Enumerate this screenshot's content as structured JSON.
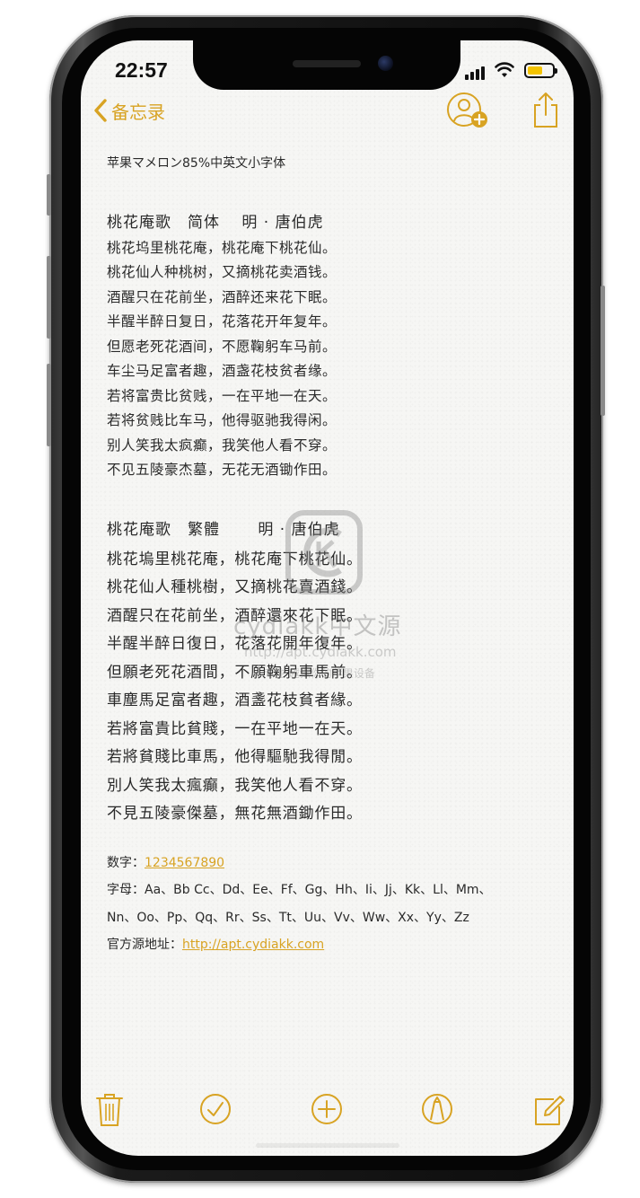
{
  "status_bar": {
    "time": "22:57"
  },
  "nav": {
    "back_label": "备忘录"
  },
  "note": {
    "title": "苹果マメロン85%中英文小字体",
    "poem_simplified": {
      "heading": "桃花庵歌　简体　 明 · 唐伯虎",
      "lines": [
        "桃花坞里桃花庵，桃花庵下桃花仙。",
        "桃花仙人种桃树，又摘桃花卖酒钱。",
        "酒醒只在花前坐，酒醉还来花下眠。",
        "半醒半醉日复日，花落花开年复年。",
        "但愿老死花酒间，不愿鞠躬车马前。",
        "车尘马足富者趣，酒盏花枝贫者缘。",
        "若将富贵比贫贱，一在平地一在天。",
        "若将贫贱比车马，他得驱驰我得闲。",
        "别人笑我太疯癫，我笑他人看不穿。",
        "不见五陵豪杰墓，无花无酒锄作田。"
      ]
    },
    "poem_traditional": {
      "heading": "桃花庵歌　繁體　　 明 · 唐伯虎",
      "lines": [
        "桃花塢里桃花庵，桃花庵下桃花仙。",
        "桃花仙人種桃樹，又摘桃花賣酒錢。",
        "酒醒只在花前坐，酒醉還來花下眠。",
        "半醒半醉日復日，花落花開年復年。",
        "但願老死花酒間，不願鞠躬車馬前。",
        "車塵馬足富者趣，酒盞花枝貧者緣。",
        "若將富貴比貧賤，一在平地一在天。",
        "若將貧賤比車馬，他得驅馳我得閒。",
        "別人笑我太瘋癲，我笑他人看不穿。",
        "不見五陵豪傑墓，無花無酒鋤作田。"
      ]
    },
    "digits_label": "数字：",
    "digits_value": "1234567890",
    "letters_line1": "字母：Aa、Bb Cc、Dd、Ee、Ff、Gg、Hh、Ii、Jj、Kk、Ll、Mm、",
    "letters_line2": "Nn、Oo、Pp、Qq、Rr、Ss、Tt、Uu、Vv、Ww、Xx、Yy、Zz",
    "source_label": "官方源地址：",
    "source_url": "http://apt.cydiakk.com"
  },
  "watermark": {
    "brand": "cydiakk中文源",
    "url": "http://apt.cydiakk.com",
    "tagline": "专注 越狱你的苹果设备"
  },
  "toolbar": {
    "icons": [
      "trash-icon",
      "checklist-icon",
      "add-icon",
      "markup-icon",
      "compose-icon"
    ]
  },
  "colors": {
    "accent": "#d8a323",
    "text": "#2a2a2a",
    "paper": "#f6f6f4"
  }
}
